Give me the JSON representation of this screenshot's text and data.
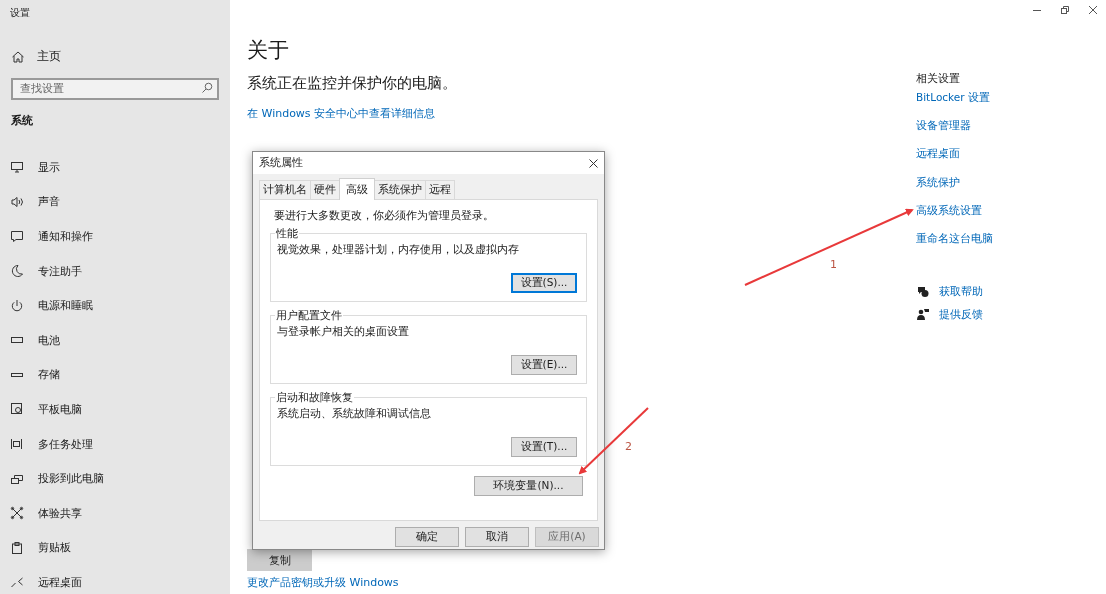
{
  "window": {
    "title": "设置"
  },
  "sidebar": {
    "home": "主页",
    "search": {
      "placeholder": "查找设置"
    },
    "section": "系统",
    "items": [
      "显示",
      "声音",
      "通知和操作",
      "专注助手",
      "电源和睡眠",
      "电池",
      "存储",
      "平板电脑",
      "多任务处理",
      "投影到此电脑",
      "体验共享",
      "剪贴板",
      "远程桌面"
    ]
  },
  "main": {
    "title": "关于",
    "status": "系统正在监控并保护你的电脑。",
    "security_link": "在 Windows 安全中心中查看详细信息",
    "copy_button": "复制",
    "upgrade_link": "更改产品密钥或升级 Windows"
  },
  "related": {
    "heading": "相关设置",
    "links": [
      "BitLocker 设置",
      "设备管理器",
      "远程桌面",
      "系统保护",
      "高级系统设置",
      "重命名这台电脑"
    ],
    "help": [
      "获取帮助",
      "提供反馈"
    ]
  },
  "dialog": {
    "title": "系统属性",
    "tabs": [
      {
        "label": "计算机名",
        "selected": false
      },
      {
        "label": "硬件",
        "selected": false
      },
      {
        "label": "高级",
        "selected": true
      },
      {
        "label": "系统保护",
        "selected": false
      },
      {
        "label": "远程",
        "selected": false
      }
    ],
    "notice": "要进行大多数更改，你必须作为管理员登录。",
    "groups": [
      {
        "title": "性能",
        "description": "视觉效果，处理器计划，内存使用，以及虚拟内存",
        "button": "设置(S)...",
        "focused": true
      },
      {
        "title": "用户配置文件",
        "description": "与登录帐户相关的桌面设置",
        "button": "设置(E)...",
        "focused": false
      },
      {
        "title": "启动和故障恢复",
        "description": "系统启动、系统故障和调试信息",
        "button": "设置(T)...",
        "focused": false
      }
    ],
    "env_button": "环境变量(N)...",
    "buttons": [
      {
        "label": "确定",
        "disabled": false
      },
      {
        "label": "取消",
        "disabled": false
      },
      {
        "label": "应用(A)",
        "disabled": true
      }
    ]
  },
  "annotations": [
    {
      "label": "1"
    },
    {
      "label": "2"
    }
  ]
}
